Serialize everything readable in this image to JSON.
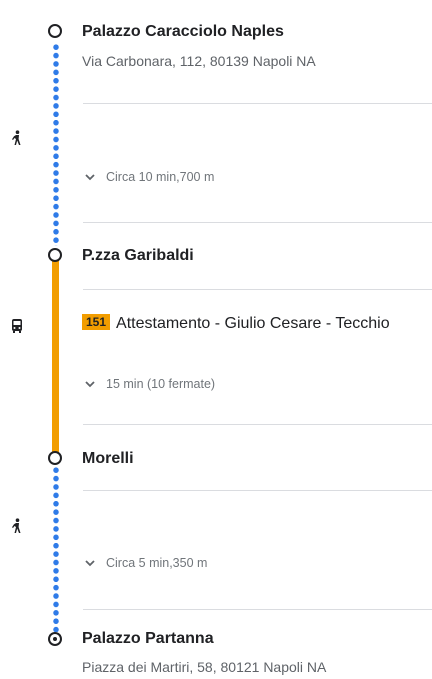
{
  "route": {
    "start": {
      "name": "Palazzo Caracciolo Naples",
      "address": "Via Carbonara, 112, 80139 Napoli NA"
    },
    "walk1": {
      "detail": "Circa 10 min,700 m",
      "icon": "walk-icon"
    },
    "stop_board": {
      "name": "P.zza Garibaldi"
    },
    "bus": {
      "line": "151",
      "headsign": "Attestamento - Giulio Cesare - Tecchio",
      "detail": "15 min (10 fermate)",
      "icon": "bus-icon",
      "line_color": "#f29d00"
    },
    "stop_alight": {
      "name": "Morelli"
    },
    "walk2": {
      "detail": "Circa 5 min,350 m",
      "icon": "walk-icon"
    },
    "end": {
      "name": "Palazzo Partanna",
      "address": "Piazza dei Martiri, 58, 80121 Napoli NA"
    }
  },
  "colors": {
    "walk_dots": "#2f7be8",
    "bus_line": "#f29d00",
    "text": "#202124",
    "secondary": "#5f6368"
  }
}
